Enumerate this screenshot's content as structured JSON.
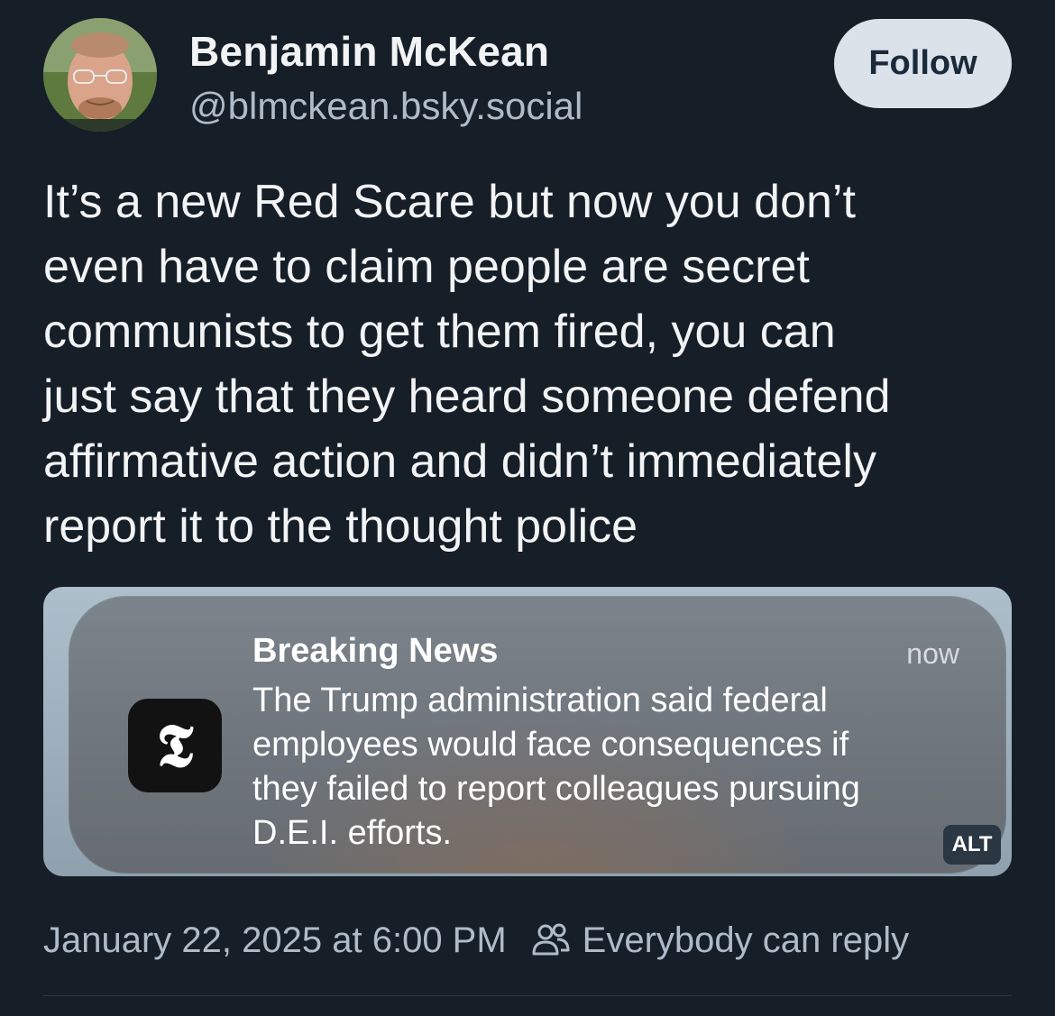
{
  "author": {
    "display_name": "Benjamin McKean",
    "handle": "@blmckean.bsky.social"
  },
  "follow_label": "Follow",
  "post": {
    "text": "It’s a new Red Scare but now you don’t\neven have to claim people are secret\ncommunists to get them fired, you can\njust say that they heard someone defend\naffirmative action and didn’t immediately\nreport it to the thought police"
  },
  "embed": {
    "app_icon_glyph": "𝕿",
    "title": "Breaking News",
    "time": "now",
    "body": "The Trump administration said federal\nemployees would face consequences if\nthey failed to report colleagues pursuing\nD.E.I. efforts.",
    "alt_label": "ALT"
  },
  "meta": {
    "timestamp": "January 22, 2025 at 6:00 PM",
    "reply_setting": "Everybody can reply",
    "reply_icon": "people-icon"
  },
  "colors": {
    "background": "#161e27",
    "follow_button": "#dce2ea",
    "secondary_text": "#aebbc9"
  }
}
